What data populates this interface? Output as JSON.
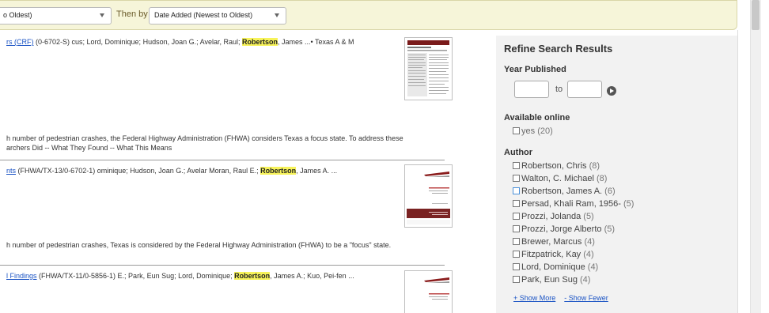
{
  "sort": {
    "primary": "o Oldest)",
    "then_by_label": "Then by",
    "secondary": "Date Added (Newest to Oldest)"
  },
  "results": [
    {
      "link": "rs (CRF)",
      "meta": " (0-6702-S) cus; Lord, Dominique; Hudson, Joan G.; Avelar, Raul; ",
      "highlight": "Robertson",
      "after": ", James ...• Texas A & M",
      "abstract_1": "h number of pedestrian crashes, the Federal Highway Administration (FHWA) considers Texas a focus state. To address these",
      "abstract_2": "archers Did -- What They Found -- What This Means"
    },
    {
      "link": "nts",
      "meta": " (FHWA/TX-13/0-6702-1) ominique; Hudson, Joan G.; Avelar Moran, Raul E.; ",
      "highlight": "Robertson",
      "after": ", James A. ...",
      "abstract_1": "h number of pedestrian crashes, Texas is considered by the Federal Highway Administration (FHWA) to be a \"focus\" state."
    },
    {
      "link": "l Findings",
      "meta": " (FHWA/TX-11/0-5856-1) E.; Park, Eun Sug; Lord, Dominique; ",
      "highlight": "Robertson",
      "after": ", James A.; Kuo, Pei-fen ..."
    }
  ],
  "refine": {
    "title": "Refine Search Results",
    "year_heading": "Year Published",
    "year_to": "to",
    "online_heading": "Available online",
    "online_option": "yes",
    "online_count": "(20)",
    "author_heading": "Author",
    "authors": [
      {
        "name": "Robertson, Chris",
        "count": "(8)"
      },
      {
        "name": "Walton, C. Michael",
        "count": "(8)"
      },
      {
        "name": "Robertson, James A.",
        "count": "(6)"
      },
      {
        "name": "Persad, Khali Ram, 1956-",
        "count": "(5)"
      },
      {
        "name": "Prozzi, Jolanda",
        "count": "(5)"
      },
      {
        "name": "Prozzi, Jorge Alberto",
        "count": "(5)"
      },
      {
        "name": "Brewer, Marcus",
        "count": "(4)"
      },
      {
        "name": "Fitzpatrick, Kay",
        "count": "(4)"
      },
      {
        "name": "Lord, Dominique",
        "count": "(4)"
      },
      {
        "name": "Park, Eun Sug",
        "count": "(4)"
      }
    ],
    "show_more": "+ Show More",
    "show_fewer": "- Show Fewer"
  }
}
